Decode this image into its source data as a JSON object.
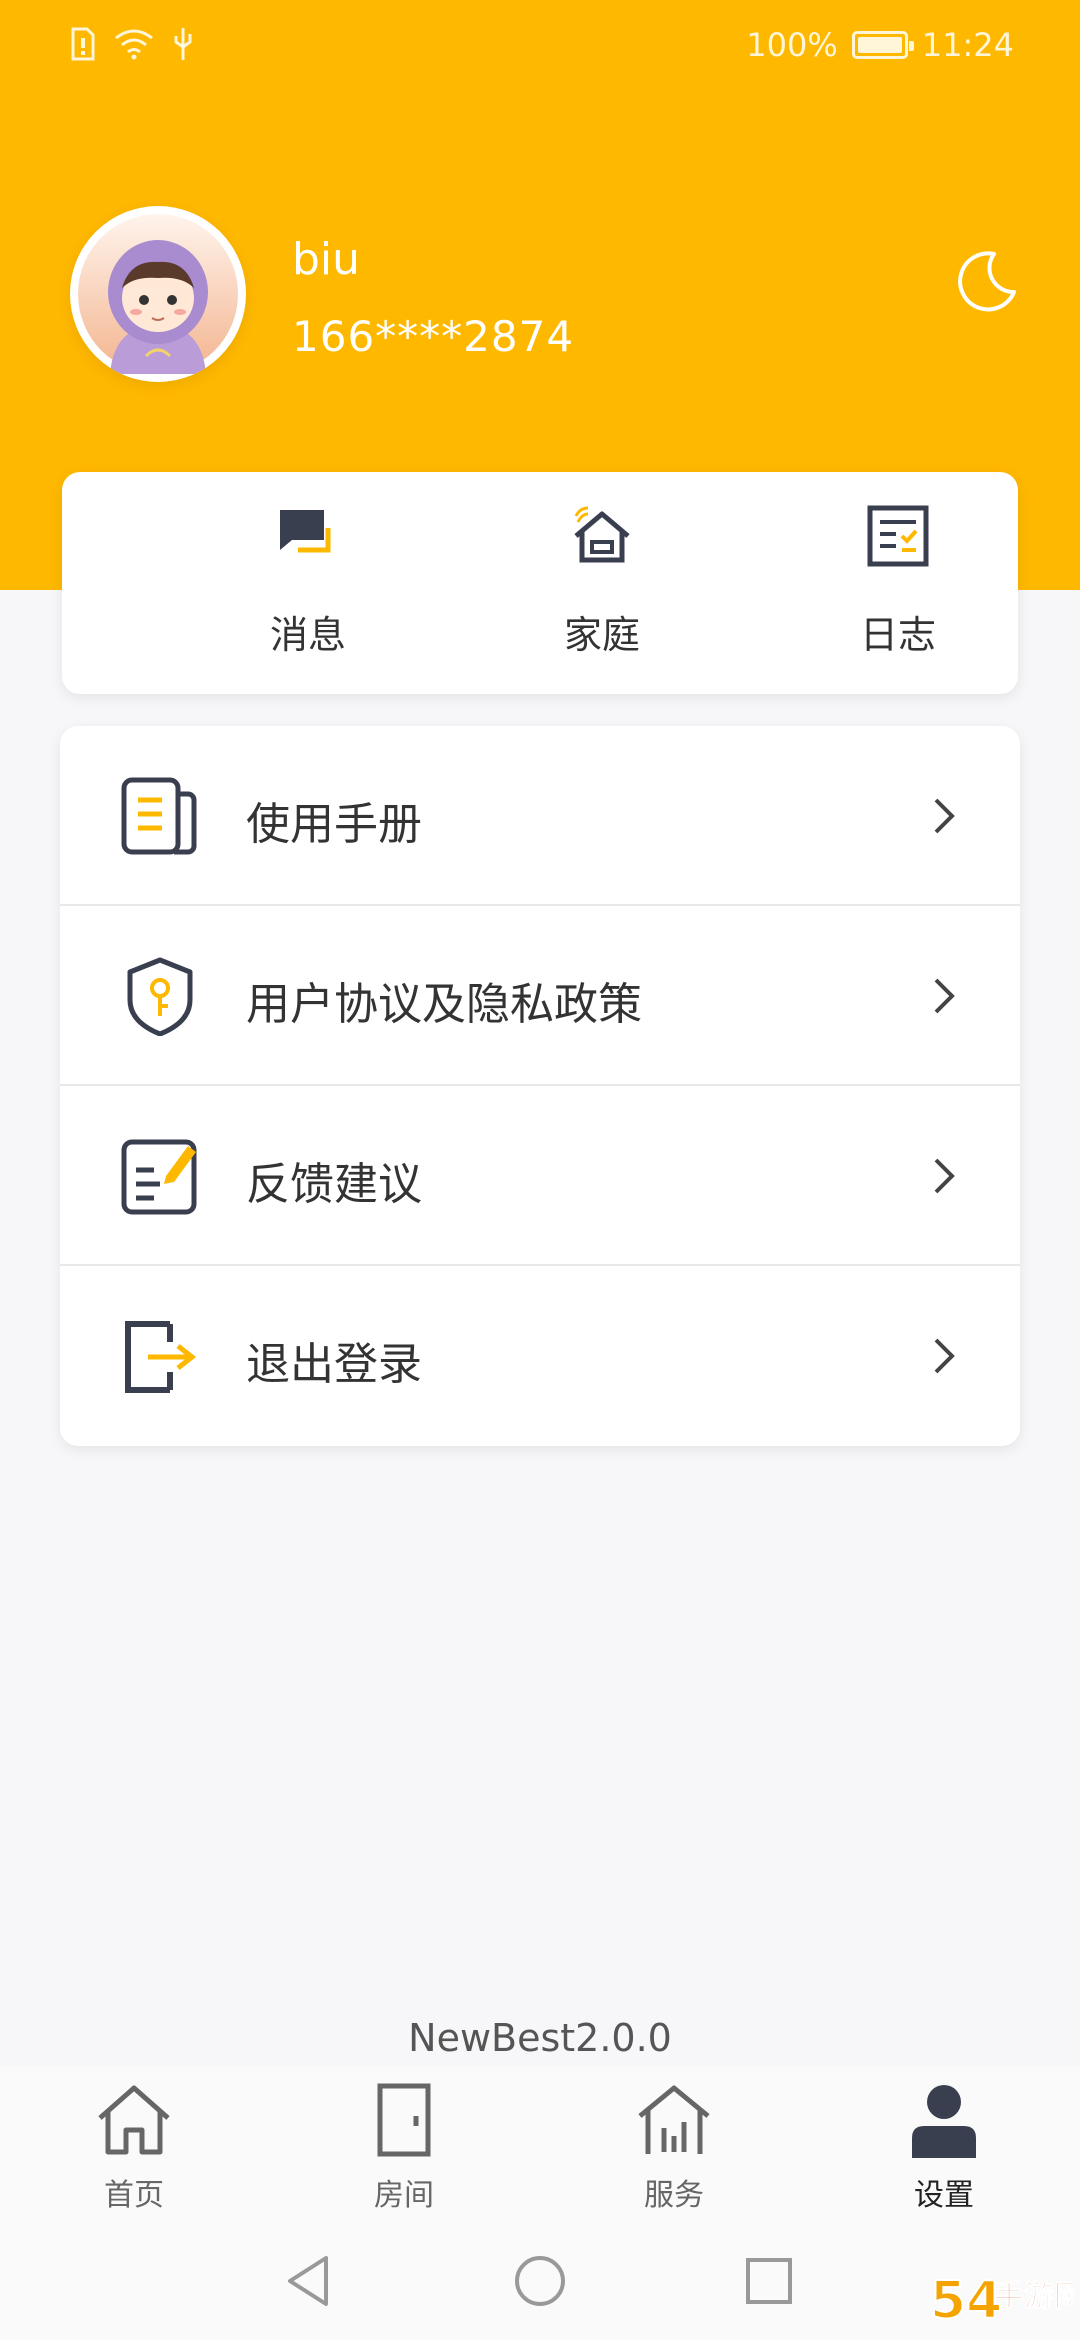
{
  "status_bar": {
    "battery": "100%",
    "time": "11:24"
  },
  "profile": {
    "name": "biu",
    "phone": "166****2874"
  },
  "quick_actions": [
    {
      "label": "消息",
      "icon": "message-icon"
    },
    {
      "label": "家庭",
      "icon": "home-wifi-icon"
    },
    {
      "label": "日志",
      "icon": "log-icon"
    }
  ],
  "menu": [
    {
      "label": "使用手册",
      "icon": "manual-icon"
    },
    {
      "label": "用户协议及隐私政策",
      "icon": "shield-key-icon"
    },
    {
      "label": "反馈建议",
      "icon": "feedback-icon"
    },
    {
      "label": "退出登录",
      "icon": "logout-icon"
    }
  ],
  "version": "NewBest2.0.0",
  "bottom_nav": [
    {
      "label": "首页",
      "icon": "home-icon",
      "active": false
    },
    {
      "label": "房间",
      "icon": "door-icon",
      "active": false
    },
    {
      "label": "服务",
      "icon": "service-icon",
      "active": false
    },
    {
      "label": "设置",
      "icon": "person-icon",
      "active": true
    }
  ],
  "watermark": "54手游网",
  "colors": {
    "accent": "#ffb800",
    "icon_dark": "#3a3f4f",
    "background": "#f7f7f9"
  }
}
